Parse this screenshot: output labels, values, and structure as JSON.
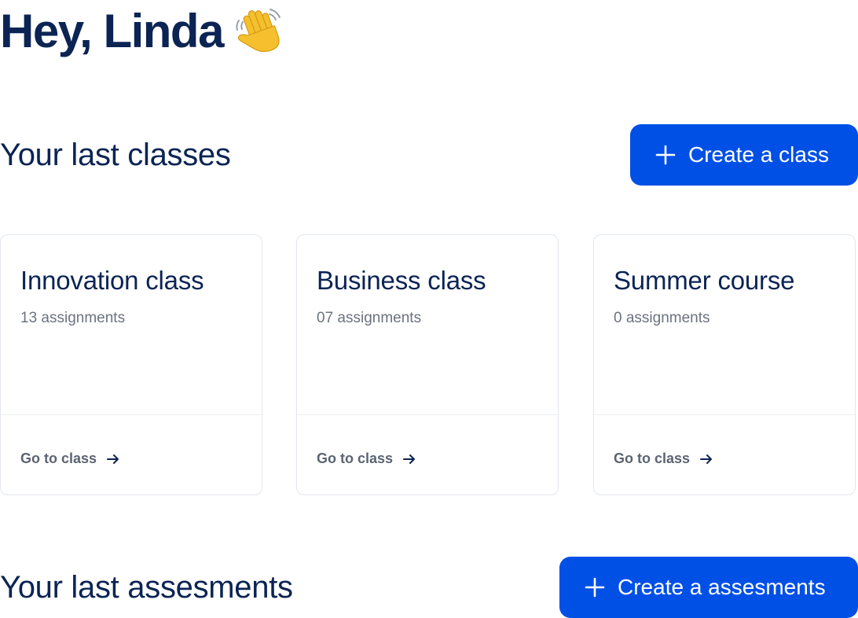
{
  "greeting": {
    "text": "Hey, Linda",
    "icon": "waving-hand-icon"
  },
  "classes_section": {
    "title": "Your last classes",
    "create_button": {
      "label": "Create a class",
      "icon": "plus-icon"
    },
    "cards": [
      {
        "title": "Innovation class",
        "assignments": "13 assignments",
        "link_label": "Go to class",
        "link_icon": "arrow-right-icon"
      },
      {
        "title": "Business class",
        "assignments": "07 assignments",
        "link_label": "Go to class",
        "link_icon": "arrow-right-icon"
      },
      {
        "title": "Summer course",
        "assignments": "0 assignments",
        "link_label": "Go to class",
        "link_icon": "arrow-right-icon"
      }
    ]
  },
  "assessments_section": {
    "title": "Your last assesments",
    "create_button": {
      "label": "Create a assesments",
      "icon": "plus-icon"
    }
  },
  "colors": {
    "primary": "#0050e6",
    "heading": "#0b2454",
    "muted": "#6b7280"
  }
}
